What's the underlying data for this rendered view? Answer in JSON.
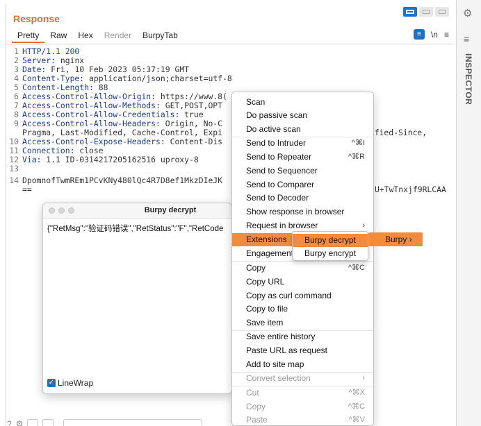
{
  "panel": {
    "title": "Response",
    "tabs": [
      "Pretty",
      "Raw",
      "Hex",
      "Render",
      "BurpyTab"
    ],
    "tools": {
      "wrap_icon": "≡",
      "newline": "\\n",
      "menu": "≡"
    }
  },
  "editor_lines": [
    {
      "n": "1",
      "name": "HTTP/1.1 200",
      "value": ""
    },
    {
      "n": "2",
      "name": "Server:",
      "value": " nginx"
    },
    {
      "n": "3",
      "name": "Date:",
      "value": " Fri, 10 Feb 2023 05:37:19 GMT"
    },
    {
      "n": "4",
      "name": "Content-Type:",
      "value": " application/json;charset=utf-8"
    },
    {
      "n": "5",
      "name": "Content-Length:",
      "value": " 88"
    },
    {
      "n": "6",
      "name": "Access-Control-Allow-Origin:",
      "value": " https://www.8("
    },
    {
      "n": "7",
      "name": "Access-Control-Allow-Methods:",
      "value": " GET,POST,OPT"
    },
    {
      "n": "8",
      "name": "Access-Control-Allow-Credentials:",
      "value": " true"
    },
    {
      "n": "9",
      "name": "Access-Control-Allow-Headers:",
      "value": " Origin, No-C"
    },
    {
      "n": "",
      "name": "",
      "value": "Pragma, Last-Modified, Cache-Control, Expi"
    },
    {
      "n": "10",
      "name": "Access-Control-Expose-Headers:",
      "value": " Content-Dis"
    },
    {
      "n": "11",
      "name": "Connection:",
      "value": " close"
    },
    {
      "n": "12",
      "name": "Via:",
      "value": " 1.1 ID-0314217205162516 uproxy-8"
    },
    {
      "n": "13",
      "name": "",
      "value": ""
    },
    {
      "n": "14",
      "name": "",
      "value": "DpomnofTwmREm1PCvKNy480lQc4R7D8ef1MkzDIeJK"
    },
    {
      "n": "",
      "name": "",
      "value": "=="
    }
  ],
  "right_overflow": {
    "line9": "dified-Since,",
    "line14": "U+TwTnxjf9RLCAA"
  },
  "sidebar": {
    "label": "INSPECTOR"
  },
  "decrypt_window": {
    "title": "Burpy decrypt",
    "content": "{\"RetMsg\":\"验证码错误\",\"RetStatus\":\"F\",\"RetCode",
    "linewrap_label": "LineWrap",
    "linewrap_checked": true
  },
  "context_menu": {
    "items": [
      {
        "label": "Scan",
        "shortcut": ""
      },
      {
        "label": "Do passive scan",
        "shortcut": ""
      },
      {
        "label": "Do active scan",
        "shortcut": ""
      },
      {
        "label": "Send to Intruder",
        "shortcut": "^⌘I"
      },
      {
        "label": "Send to Repeater",
        "shortcut": "^⌘R"
      },
      {
        "label": "Send to Sequencer",
        "shortcut": ""
      },
      {
        "label": "Send to Comparer",
        "shortcut": ""
      },
      {
        "label": "Send to Decoder",
        "shortcut": ""
      },
      {
        "label": "Show response in browser",
        "shortcut": ""
      },
      {
        "label": "Request in browser",
        "shortcut": "›"
      },
      {
        "label": "Extensions",
        "shortcut": ""
      },
      {
        "label": "Engagement",
        "shortcut": ""
      },
      {
        "label": "Copy",
        "shortcut": "^⌘C"
      },
      {
        "label": "Copy URL",
        "shortcut": ""
      },
      {
        "label": "Copy as curl command",
        "shortcut": ""
      },
      {
        "label": "Copy to file",
        "shortcut": ""
      },
      {
        "label": "Save item",
        "shortcut": ""
      },
      {
        "label": "Save entire history",
        "shortcut": ""
      },
      {
        "label": "Paste URL as request",
        "shortcut": ""
      },
      {
        "label": "Add to site map",
        "shortcut": ""
      },
      {
        "label": "Convert selection",
        "shortcut": "›"
      },
      {
        "label": "Cut",
        "shortcut": "^⌘X"
      },
      {
        "label": "Copy",
        "shortcut": "^⌘C"
      },
      {
        "label": "Paste",
        "shortcut": "^⌘V"
      }
    ]
  },
  "extensions_submenu": [
    "Burpy decrypt",
    "Burpy encrypt"
  ],
  "burpy_submenu": {
    "label": "Burpy ›"
  },
  "colors": {
    "accent": "#e8702a",
    "highlight": "#f28c3c",
    "header_name": "#1a3a9a",
    "blue": "#1a73c8"
  }
}
